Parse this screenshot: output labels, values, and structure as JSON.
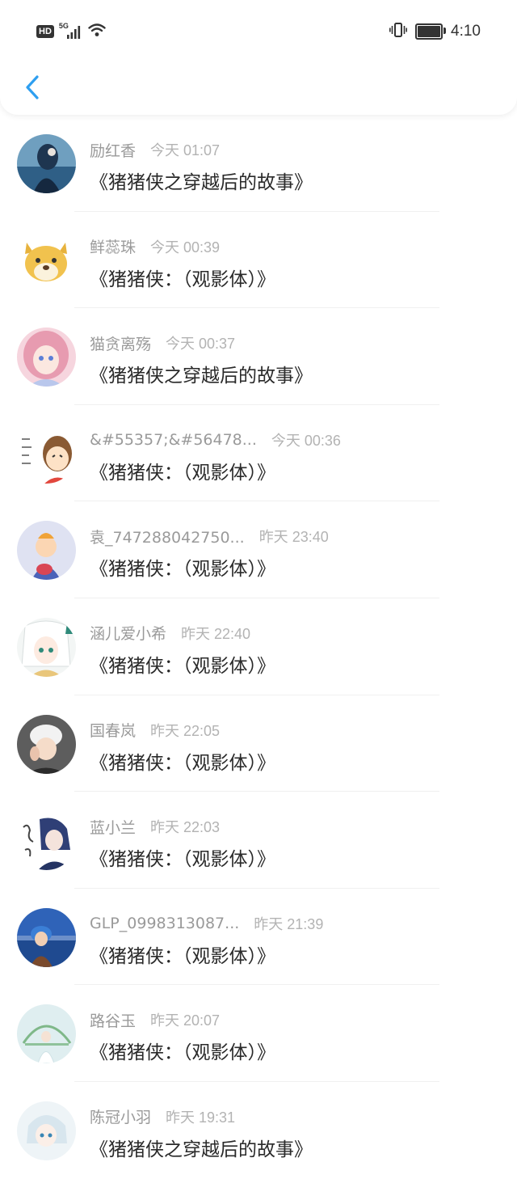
{
  "status_bar": {
    "hd": "HD",
    "network": "5G",
    "time": "4:10"
  },
  "nav": {
    "back_icon": "chevron-left-icon"
  },
  "accent": "#2e9ff0",
  "items": [
    {
      "name": "励红香",
      "time": "今天 01:07",
      "title": "《猪猪侠之穿越后的故事》"
    },
    {
      "name": "鲜蕊珠",
      "time": "今天 00:39",
      "title": "《猪猪侠：（观影体）》"
    },
    {
      "name": "猫贪离殇",
      "time": "今天 00:37",
      "title": "《猪猪侠之穿越后的故事》"
    },
    {
      "name": "&#55357;&#56478...",
      "time": "今天 00:36",
      "title": "《猪猪侠：（观影体）》"
    },
    {
      "name": "袁_747288042750...",
      "time": "昨天 23:40",
      "title": "《猪猪侠：（观影体）》"
    },
    {
      "name": "涵儿爱小希",
      "time": "昨天 22:40",
      "title": "《猪猪侠：（观影体）》"
    },
    {
      "name": "国春岚",
      "time": "昨天 22:05",
      "title": "《猪猪侠：（观影体）》"
    },
    {
      "name": "蓝小兰",
      "time": "昨天 22:03",
      "title": "《猪猪侠：（观影体）》"
    },
    {
      "name": "GLP_0998313087...",
      "time": "昨天 21:39",
      "title": "《猪猪侠：（观影体）》"
    },
    {
      "name": "路谷玉",
      "time": "昨天 20:07",
      "title": "《猪猪侠：（观影体）》"
    },
    {
      "name": "陈冠小羽",
      "time": "昨天 19:31",
      "title": "《猪猪侠之穿越后的故事》"
    }
  ]
}
